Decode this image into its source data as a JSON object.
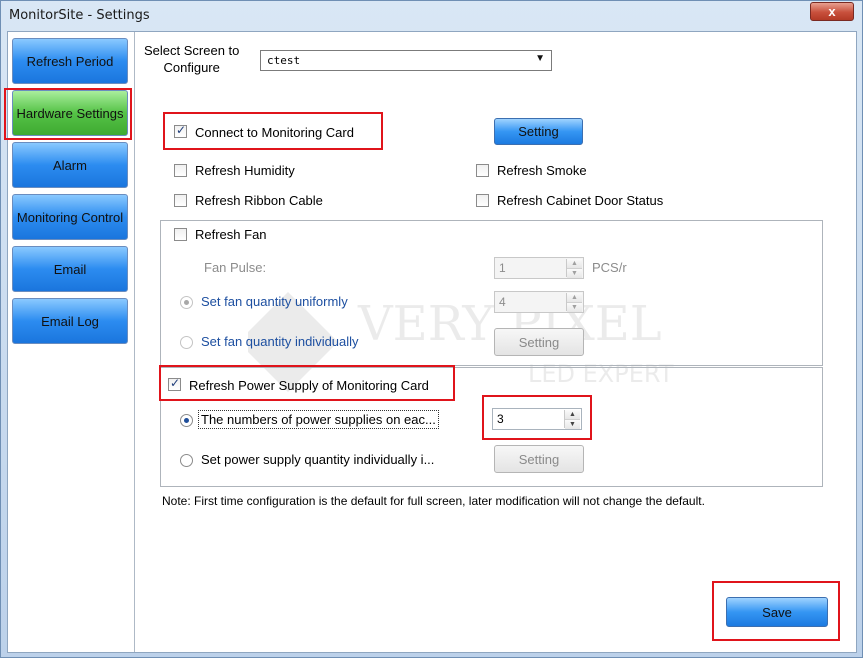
{
  "window": {
    "title": "MonitorSite - Settings",
    "close_label": "x"
  },
  "sidebar": {
    "items": [
      {
        "label": "Refresh Period"
      },
      {
        "label": "Hardware Settings"
      },
      {
        "label": "Alarm"
      },
      {
        "label": "Monitoring Control"
      },
      {
        "label": "Email"
      },
      {
        "label": "Email Log"
      }
    ],
    "active_index": 1
  },
  "screen_select": {
    "label_line1": "Select Screen to",
    "label_line2": "Configure",
    "value": "ctest"
  },
  "hardware": {
    "connect_card": {
      "label": "Connect to Monitoring Card",
      "checked": true
    },
    "setting_button": "Setting",
    "refresh_humidity": {
      "label": "Refresh Humidity",
      "checked": false
    },
    "refresh_smoke": {
      "label": "Refresh Smoke",
      "checked": false
    },
    "refresh_ribbon": {
      "label": "Refresh Ribbon Cable",
      "checked": false
    },
    "refresh_cabinet_door": {
      "label": "Refresh Cabinet Door Status",
      "checked": false
    }
  },
  "fan_group": {
    "refresh_fan": {
      "label": "Refresh Fan",
      "checked": false
    },
    "fan_pulse_label": "Fan Pulse:",
    "fan_pulse_value": "1",
    "fan_pulse_unit": "PCS/r",
    "uniform_label": "Set fan quantity uniformly",
    "uniform_value": "4",
    "individual_label": "Set fan quantity individually",
    "individual_button": "Setting"
  },
  "power_group": {
    "refresh_power": {
      "label": "Refresh Power Supply of Monitoring Card",
      "checked": true
    },
    "numbers_label": "The numbers of power supplies on eac...",
    "numbers_value": "3",
    "individual_label": "Set power supply quantity individually i...",
    "individual_button": "Setting"
  },
  "note": "Note: First time configuration is the default for full screen, later modification will not change the default.",
  "save_label": "Save",
  "watermark": {
    "line1": "VERY PIXEL",
    "line2": "LED EXPERT"
  },
  "colors": {
    "nav_blue": "#2c8cf0",
    "nav_active_green": "#55c246",
    "highlight_red": "#e0141b"
  }
}
